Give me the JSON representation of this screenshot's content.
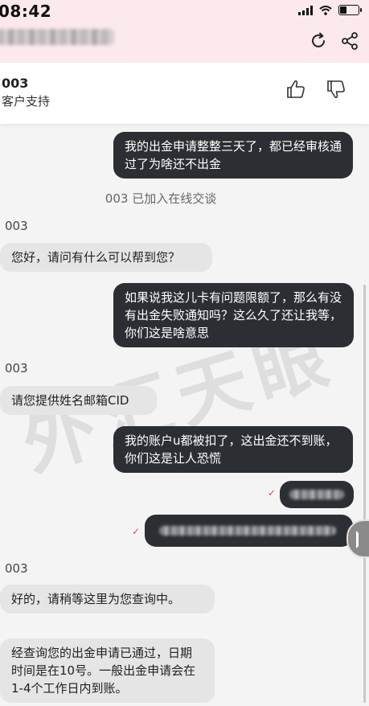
{
  "status_bar": {
    "time": "08:42"
  },
  "agent": {
    "id": "003",
    "role": "客户支持"
  },
  "messages": {
    "m1": "我的出金申请整整三天了，都已经审核通过了为啥还不出金",
    "sys1": "003 已加入在线交谈",
    "sender": "003",
    "m2": "您好，请问有什么可以帮到您？",
    "m3": "如果说我这儿卡有问题限额了，那么有没有出金失败通知吗？这么久了还让我等，你们这是啥意思",
    "m4": "请您提供姓名邮箱CID",
    "m5": "我的账户u都被扣了，这出金还不到账，你们这是让人恐慌",
    "m6": "好的，请稍等这里为您查询中。",
    "m7": "经查询您的出金申请已通过，日期时间是在10号。一般出金申请会在1-4个工作日内到账。"
  },
  "icons": [
    "refresh-icon",
    "share-icon",
    "thumbs-up-icon",
    "thumbs-down-icon",
    "signal-icon",
    "wifi-icon",
    "battery-icon",
    "sent-check-icon",
    "collapse-tab-icon"
  ],
  "colors": {
    "outgoing_bubble": "#2b2f33",
    "incoming_bubble": "#e5e5e5",
    "topbar": "#fbe9ec"
  }
}
